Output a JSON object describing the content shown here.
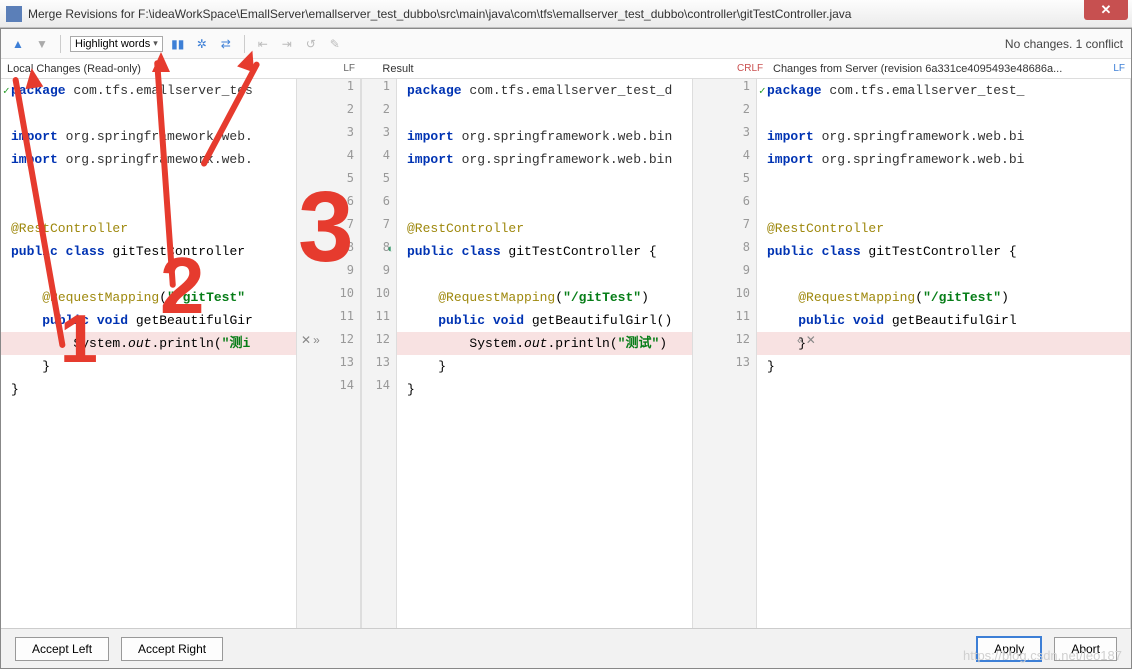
{
  "window": {
    "title": "Merge Revisions for F:\\ideaWorkSpace\\EmallServer\\emallserver_test_dubbo\\src\\main\\java\\com\\tfs\\emallserver_test_dubbo\\controller\\gitTestController.java"
  },
  "toolbar": {
    "dropdown_label": "Highlight words",
    "status": "No changes. 1 conflict"
  },
  "headers": {
    "left_title": "Local Changes (Read-only)",
    "left_enc": "LF",
    "mid_title": "Result",
    "mid_enc": "CRLF",
    "right_title": "Changes from Server (revision 6a331ce4095493e48686a...",
    "right_enc": "LF"
  },
  "gutters": {
    "left": [
      "1",
      "2",
      "3",
      "4",
      "5",
      "6",
      "7",
      "8",
      "9",
      "10",
      "11",
      "12",
      "13",
      "14"
    ],
    "mid": [
      "1",
      "2",
      "3",
      "4",
      "5",
      "6",
      "7",
      "8",
      "9",
      "10",
      "11",
      "12",
      "13",
      "14"
    ],
    "right": [
      "1",
      "2",
      "3",
      "4",
      "5",
      "6",
      "7",
      "8",
      "9",
      "10",
      "11",
      "12",
      "13"
    ]
  },
  "code": {
    "left": [
      {
        "t": "package ",
        "k": "kw"
      },
      {
        "r": "com.tfs.emallserver_tes"
      },
      "",
      {
        "t": "import ",
        "k": "kw"
      },
      {
        "r": "org.springframework.web."
      },
      {
        "t": "import ",
        "k": "kw"
      },
      {
        "r2": "org.springframework.web."
      },
      "",
      "",
      {
        "ann": "@RestController"
      },
      {
        "pub": "public class ",
        "nm": "gitTestController"
      },
      "",
      {
        "ind": "    ",
        "ann": "@RequestMapping",
        "p": "(",
        "s": "\"/gitTest\""
      },
      {
        "ind": "    ",
        "pub": "public void ",
        "nm": "getBeautifulGir"
      },
      {
        "ind": "        ",
        "sys": "System.",
        "out": "out",
        "pr": ".println(",
        "s": "\"测i"
      },
      {
        "ind": "    ",
        "b": "}"
      },
      {
        "b": "}"
      }
    ],
    "mid": [
      {
        "t": "package ",
        "k": "kw"
      },
      {
        "r": "com.tfs.emallserver_test_d"
      },
      "",
      {
        "t": "import ",
        "k": "kw"
      },
      {
        "r": "org.springframework.web.bin"
      },
      {
        "t": "import ",
        "k": "kw"
      },
      {
        "r2": "org.springframework.web.bin"
      },
      "",
      "",
      {
        "ann": "@RestController"
      },
      {
        "pub": "public class ",
        "nm": "gitTestController {"
      },
      "",
      {
        "ind": "    ",
        "ann": "@RequestMapping",
        "p": "(",
        "s": "\"/gitTest\"",
        "e": ")"
      },
      {
        "ind": "    ",
        "pub": "public void ",
        "nm": "getBeautifulGirl()"
      },
      {
        "ind": "        ",
        "sys": "System.",
        "out": "out",
        "pr": ".println(",
        "s": "\"测试\"",
        "e": ")"
      },
      {
        "ind": "    ",
        "b": "}"
      },
      {
        "b": "}"
      }
    ],
    "right": [
      {
        "t": "package ",
        "k": "kw"
      },
      {
        "r": "com.tfs.emallserver_test_"
      },
      "",
      {
        "t": "import ",
        "k": "kw"
      },
      {
        "r": "org.springframework.web.bi"
      },
      {
        "t": "import ",
        "k": "kw"
      },
      {
        "r2": "org.springframework.web.bi"
      },
      "",
      "",
      {
        "ann": "@RestController"
      },
      {
        "pub": "public class ",
        "nm": "gitTestController {"
      },
      "",
      {
        "ind": "    ",
        "ann": "@RequestMapping",
        "p": "(",
        "s": "\"/gitTest\"",
        "e": ")"
      },
      {
        "ind": "    ",
        "pub": "public void ",
        "nm": "getBeautifulGirl"
      },
      {
        "ind": "    ",
        "b": "}"
      },
      {
        "b": "}"
      }
    ]
  },
  "footer": {
    "accept_left": "Accept Left",
    "accept_right": "Accept Right",
    "apply": "Apply",
    "abort": "Abort"
  },
  "watermark": "https://blog.csdn.net/leo187",
  "annotations": {
    "n1": "1",
    "n2": "2",
    "n3": "3"
  }
}
